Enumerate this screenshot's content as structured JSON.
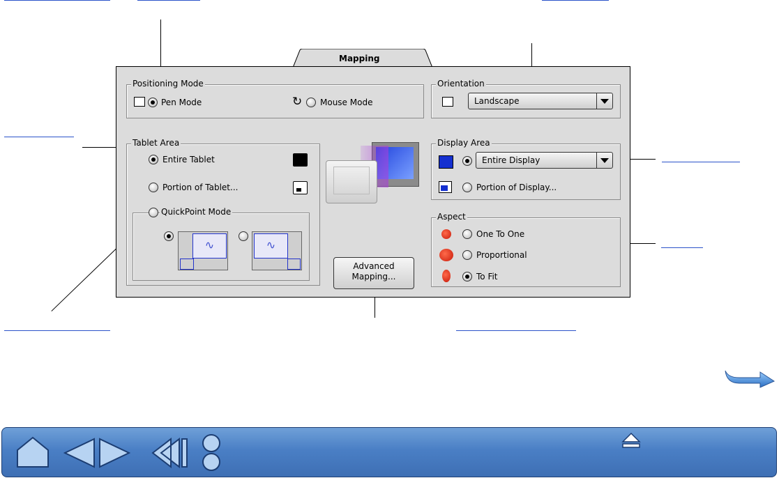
{
  "window": {
    "tab_label": "Mapping"
  },
  "positioning_mode": {
    "label": "Positioning Mode",
    "pen_mode": "Pen Mode",
    "mouse_mode": "Mouse Mode",
    "selected": "Pen Mode"
  },
  "orientation": {
    "label": "Orientation",
    "value": "Landscape"
  },
  "tablet_area": {
    "label": "Tablet Area",
    "entire_tablet": "Entire Tablet",
    "portion_of_tablet": "Portion of Tablet...",
    "selected": "Entire Tablet"
  },
  "quickpoint": {
    "label": "QuickPoint Mode",
    "selected_option": 1
  },
  "display_area": {
    "label": "Display Area",
    "value": "Entire Display",
    "portion_of_display": "Portion of Display..."
  },
  "aspect": {
    "label": "Aspect",
    "one_to_one": "One To One",
    "proportional": "Proportional",
    "to_fit": "To Fit",
    "selected": "To Fit"
  },
  "buttons": {
    "advanced_mapping_line1": "Advanced",
    "advanced_mapping_line2": "Mapping..."
  },
  "colors": {
    "link": "#2a52c9",
    "panel": "#dcdcdc",
    "nav_bar": "#4a7fc5"
  }
}
